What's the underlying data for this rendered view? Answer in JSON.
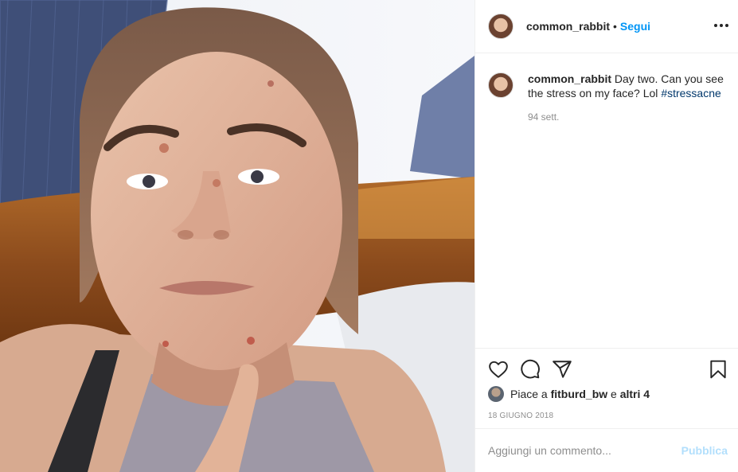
{
  "post": {
    "username": "common_rabbit",
    "separator": "•",
    "follow_label": "Segui",
    "more_icon": "more-horizontal-icon",
    "photo_description_icon": "photo"
  },
  "caption": {
    "username": "common_rabbit",
    "text": "Day two. Can you see the stress on my face? Lol",
    "hashtag": "#stressacne",
    "time": "94 sett."
  },
  "actions": {
    "like_icon": "heart-icon",
    "comment_icon": "comment-icon",
    "share_icon": "share-icon",
    "save_icon": "bookmark-icon"
  },
  "likes": {
    "prefix": "Piace a",
    "user": "fitburd_bw",
    "connector": "e",
    "others": "altri 4"
  },
  "date": "18 GIUGNO 2018",
  "comment": {
    "placeholder": "Aggiungi un commento...",
    "publish_label": "Pubblica"
  },
  "colors": {
    "accent": "#0095f6",
    "hashtag": "#00376b",
    "muted": "#8e8e8e",
    "publish_disabled": "#b2dffc"
  }
}
